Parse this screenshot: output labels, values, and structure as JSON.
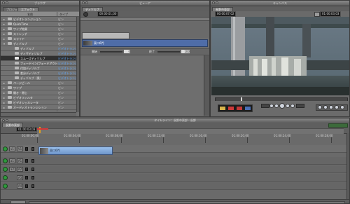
{
  "browser": {
    "title": "ブラウザ",
    "tabs": [
      "プロジェクト",
      "エフェクト"
    ],
    "columns": {
      "name": "名前",
      "type": "タイプ"
    },
    "items": [
      {
        "name": "ビデオトランジション",
        "type": "ビン",
        "expandable": true,
        "selected": false
      },
      {
        "name": "QuickTime",
        "type": "ビン",
        "expandable": true,
        "selected": false
      },
      {
        "name": "ワイプ効果",
        "type": "ビン",
        "expandable": true,
        "selected": false
      },
      {
        "name": "ストレッチ",
        "type": "ビン",
        "expandable": true,
        "selected": false
      },
      {
        "name": "スライド",
        "type": "ビン",
        "expandable": true,
        "selected": false
      },
      {
        "name": "ディゾルブ",
        "type": "ビン",
        "expandable": true,
        "selected": false
      },
      {
        "name": "ディゾルブ",
        "type": "ビデオトランジション",
        "expandable": false,
        "selected": false
      },
      {
        "name": "ディザディゾルブ",
        "type": "ビデオトランジション",
        "expandable": false,
        "selected": false
      },
      {
        "name": "スムーズディゾルブ",
        "type": "ビデオトランジション",
        "expandable": false,
        "selected": true
      },
      {
        "name": "フェードイン/フェードアウト",
        "type": "ビデオトランジション",
        "expandable": false,
        "selected": false
      },
      {
        "name": "付加ディゾルブ",
        "type": "ビデオトランジション",
        "expandable": false,
        "selected": false
      },
      {
        "name": "差分ディゾルブ",
        "type": "ビデオトランジション",
        "expandable": false,
        "selected": false
      },
      {
        "name": "ディゾルブ（黒）",
        "type": "ビデオトランジション",
        "expandable": false,
        "selected": false
      },
      {
        "name": "ページピール",
        "type": "ビン",
        "expandable": true,
        "selected": false
      },
      {
        "name": "ワイプ",
        "type": "ビン",
        "expandable": true,
        "selected": false
      },
      {
        "name": "開き・閉じ",
        "type": "ビン",
        "expandable": true,
        "selected": false
      },
      {
        "name": "ビデオフィルタ",
        "type": "ビン",
        "expandable": true,
        "selected": false
      },
      {
        "name": "ビデオジェネレータ",
        "type": "ビン",
        "expandable": true,
        "selected": false
      },
      {
        "name": "オーディオトランジション",
        "type": "ビン",
        "expandable": true,
        "selected": false
      }
    ]
  },
  "viewer": {
    "title": "ビューア",
    "tab": "ディゾルブ",
    "duration": "00:00:01;00",
    "clip_label": "東口6門",
    "param_label_1": "開始",
    "param_value_1": "0",
    "param_label_2": "終了",
    "param_value_2": "100"
  },
  "canvas": {
    "title": "キャンバス",
    "tab": "長野市東部",
    "duration": "00:00:07;02",
    "timecode": "01:00:03;03"
  },
  "timeline": {
    "title": "タイムライン：長野市東部 - 長野",
    "tab": "長野市東部",
    "current_timecode": "01:00:03;03",
    "ruler": [
      "01:00:00;00",
      "01:00:04;00",
      "01:00:08;00",
      "01:00:12;00",
      "01:00:16;00",
      "01:00:20;00",
      "01:00:24;00",
      "01:00:28;00"
    ],
    "clip_label": "東口6門",
    "tracks": [
      {
        "src": "v1",
        "dst": "V1"
      },
      {
        "src": "a1",
        "dst": "A1"
      },
      {
        "src": "a2",
        "dst": "A2"
      },
      {
        "src": "",
        "dst": "A3"
      },
      {
        "src": "",
        "dst": "A4"
      }
    ]
  }
}
